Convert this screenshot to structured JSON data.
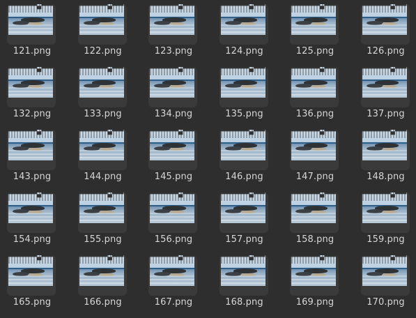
{
  "files": [
    "121.png",
    "122.png",
    "123.png",
    "124.png",
    "125.png",
    "126.png",
    "132.png",
    "133.png",
    "134.png",
    "135.png",
    "136.png",
    "137.png",
    "143.png",
    "144.png",
    "145.png",
    "146.png",
    "147.png",
    "148.png",
    "154.png",
    "155.png",
    "156.png",
    "157.png",
    "158.png",
    "159.png",
    "165.png",
    "166.png",
    "167.png",
    "168.png",
    "169.png",
    "170.png"
  ],
  "icon": "image-thumbnail-icon",
  "colors": {
    "background": "#2e2e2e",
    "label": "#d7d7d7",
    "tile": "#3a3a3a"
  }
}
